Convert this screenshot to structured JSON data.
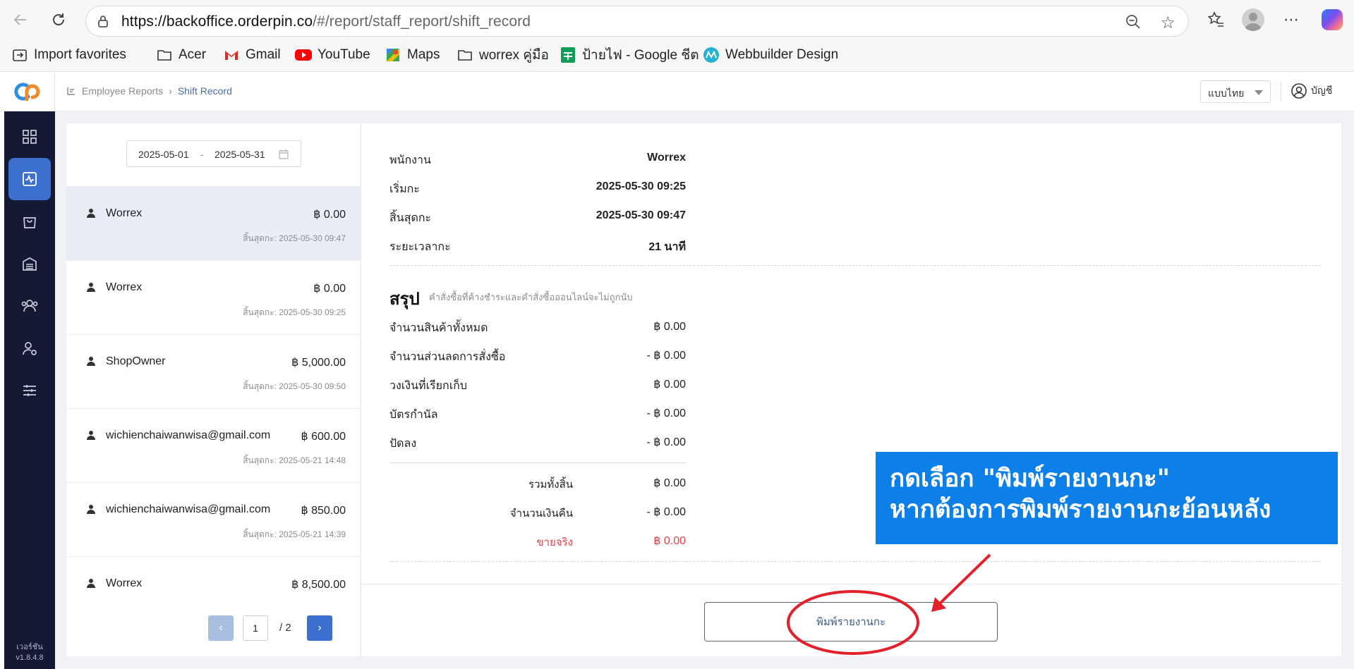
{
  "browser": {
    "url_host": "https://backoffice.orderpin.co",
    "url_path": "/#/report/staff_report/shift_record",
    "bookmarks": [
      {
        "label": "Import favorites",
        "icon": "import-icon"
      },
      {
        "label": "Acer",
        "icon": "folder-icon"
      },
      {
        "label": "Gmail",
        "icon": "gmail-icon"
      },
      {
        "label": "YouTube",
        "icon": "youtube-icon"
      },
      {
        "label": "Maps",
        "icon": "maps-icon"
      },
      {
        "label": "worrex คู่มือ",
        "icon": "folder-icon"
      },
      {
        "label": "ป้ายไฟ - Google ชีต",
        "icon": "sheets-icon"
      },
      {
        "label": "Webbuilder Design",
        "icon": "webbuilder-icon"
      }
    ]
  },
  "header": {
    "breadcrumb_parent": "Employee Reports",
    "breadcrumb_current": "Shift Record",
    "language": "แบบไทย",
    "account_label": "บัญชี"
  },
  "sidebar": {
    "items": [
      {
        "icon": "dashboard-icon",
        "active": false
      },
      {
        "icon": "report-icon",
        "active": true
      },
      {
        "icon": "shopping-bag-icon",
        "active": false
      },
      {
        "icon": "warehouse-icon",
        "active": false
      },
      {
        "icon": "customers-icon",
        "active": false
      },
      {
        "icon": "staff-settings-icon",
        "active": false
      },
      {
        "icon": "sliders-icon",
        "active": false
      }
    ],
    "version_label": "เวอร์ชัน",
    "version": "v1.8.4.8"
  },
  "filters": {
    "date_start": "2025-05-01",
    "date_separator": "-",
    "date_end": "2025-05-31"
  },
  "shifts": [
    {
      "name": "Worrex",
      "amount": "฿ 0.00",
      "end": "สิ้นสุดกะ: 2025-05-30 09:47",
      "selected": true
    },
    {
      "name": "Worrex",
      "amount": "฿ 0.00",
      "end": "สิ้นสุดกะ: 2025-05-30 09:25",
      "selected": false
    },
    {
      "name": "ShopOwner",
      "amount": "฿ 5,000.00",
      "end": "สิ้นสุดกะ: 2025-05-30 09:50",
      "selected": false
    },
    {
      "name": "wichienchaiwanwisa@gmail.com",
      "amount": "฿ 600.00",
      "end": "สิ้นสุดกะ: 2025-05-21 14:48",
      "selected": false
    },
    {
      "name": "wichienchaiwanwisa@gmail.com",
      "amount": "฿ 850.00",
      "end": "สิ้นสุดกะ: 2025-05-21 14:39",
      "selected": false
    },
    {
      "name": "Worrex",
      "amount": "฿ 8,500.00",
      "end": "",
      "selected": false
    }
  ],
  "pagination": {
    "prev": "‹",
    "next": "›",
    "current": "1",
    "total": "/  2"
  },
  "detail": {
    "info": [
      {
        "label": "พนักงาน",
        "value": "Worrex"
      },
      {
        "label": "เริ่มกะ",
        "value": "2025-05-30 09:25"
      },
      {
        "label": "สิ้นสุดกะ",
        "value": "2025-05-30 09:47"
      },
      {
        "label": "ระยะเวลากะ",
        "value": "21 นาที"
      }
    ],
    "summary_title": "สรุป",
    "summary_note": "คำสั่งซื้อที่ค้างชำระและคำสั่งซื้อออนไลน์จะไม่ถูกนับ",
    "summary": [
      {
        "label": "จำนวนสินค้าทั้งหมด",
        "value": "฿ 0.00"
      },
      {
        "label": "จำนวนส่วนลดการสั่งซื้อ",
        "value": "- ฿ 0.00"
      },
      {
        "label": "วงเงินที่เรียกเก็บ",
        "value": "฿ 0.00"
      },
      {
        "label": "บัตรกำนัล",
        "value": "- ฿ 0.00"
      },
      {
        "label": "ปัดลง",
        "value": "- ฿ 0.00"
      }
    ],
    "totals": [
      {
        "label": "รวมทั้งสิ้น",
        "value": "฿ 0.00",
        "highlight": false
      },
      {
        "label": "จำนวนเงินคืน",
        "value": "- ฿ 0.00",
        "highlight": false
      },
      {
        "label": "ขายจริง",
        "value": "฿ 0.00",
        "highlight": true
      }
    ],
    "print_button": "พิมพ์รายงานกะ"
  },
  "annotation": {
    "line1": "กดเลือก \"พิมพ์รายงานกะ\"",
    "line2": "หากต้องการพิมพ์รายงานกะย้อนหลัง"
  },
  "colors": {
    "sidebar_bg": "#141a33",
    "accent": "#3d6fce",
    "callout_bg": "#0d7fe8",
    "annotation_red": "#e3202a",
    "negative_total": "#e0424a"
  }
}
